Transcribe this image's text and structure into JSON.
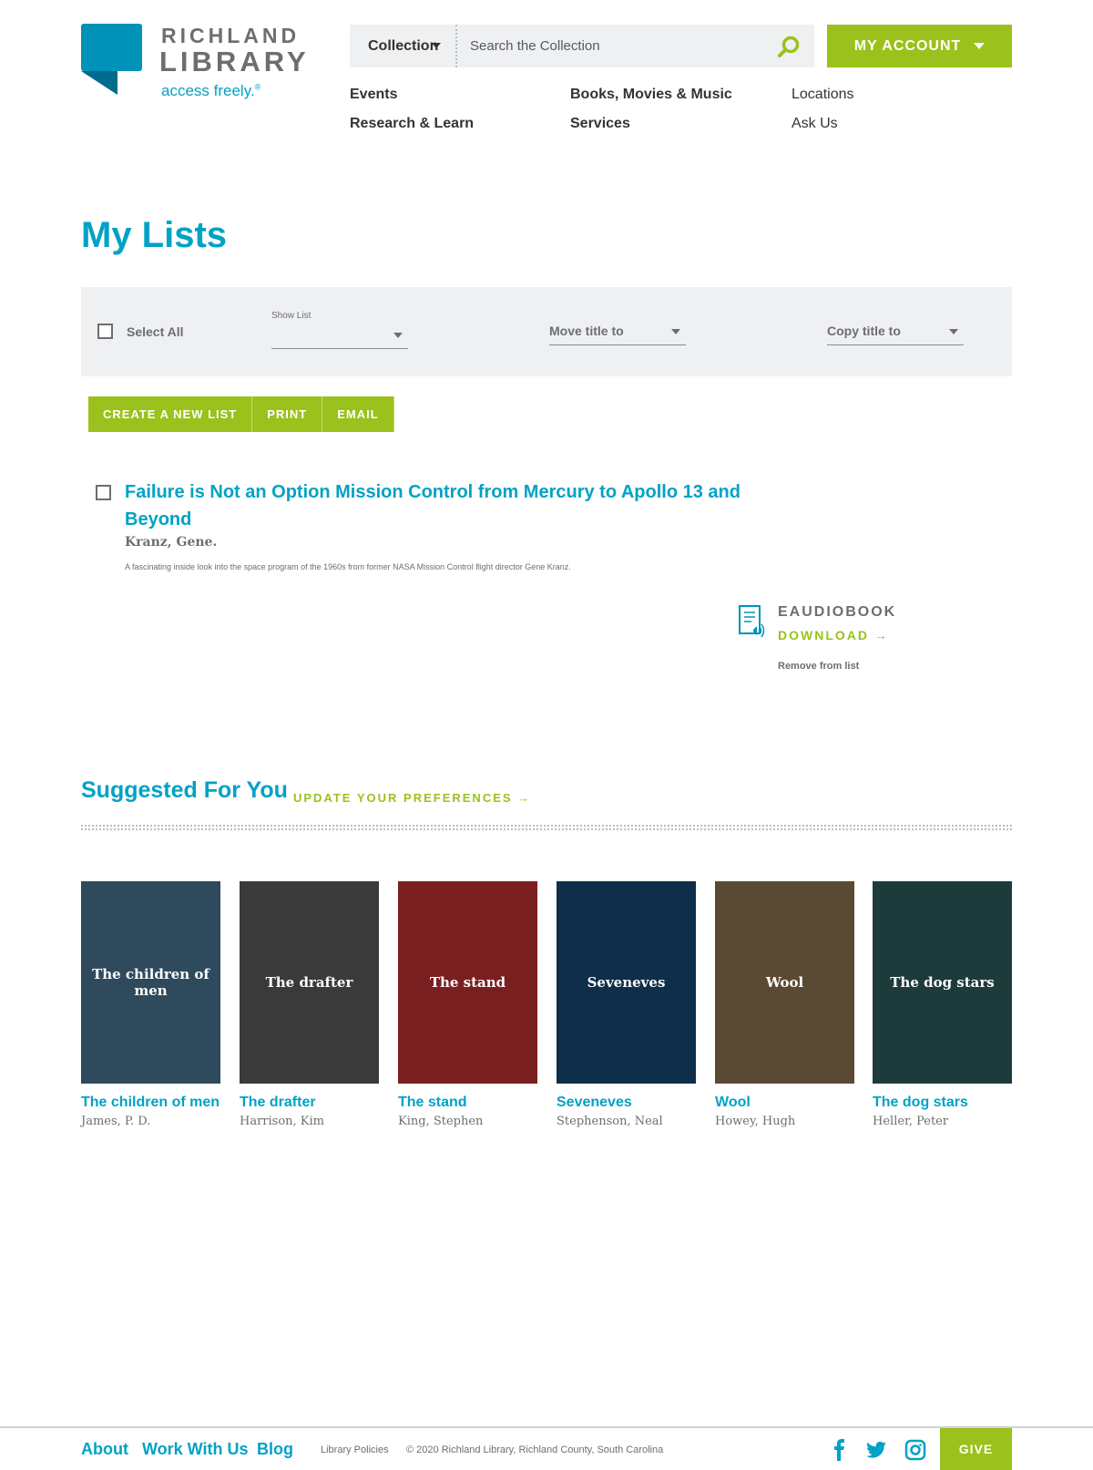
{
  "logo": {
    "line1": "RICHLAND",
    "line2": "LIBRARY",
    "tagline": "access freely.",
    "tagline_mark": "®"
  },
  "search": {
    "scope": "Collection",
    "placeholder": "Search the Collection"
  },
  "account": {
    "label": "MY ACCOUNT"
  },
  "nav": {
    "events": "Events",
    "books": "Books, Movies & Music",
    "locations": "Locations",
    "research": "Research & Learn",
    "services": "Services",
    "ask": "Ask Us"
  },
  "page_title": "My Lists",
  "toolbar": {
    "select_all": "Select All",
    "show_list_label": "Show List",
    "move_title": "Move title to",
    "copy_title": "Copy title to"
  },
  "actions": {
    "create": "CREATE A NEW LIST",
    "print": "PRINT",
    "email": "EMAIL"
  },
  "list_item": {
    "title": "Failure is Not an Option Mission Control from Mercury to Apollo 13 and Beyond",
    "author": "Kranz, Gene.",
    "description": "A fascinating inside look into the space program of the 1960s from former NASA Mission Control flight director Gene Kranz.",
    "format": "EAUDIOBOOK",
    "download": "DOWNLOAD →",
    "remove": "Remove from list"
  },
  "suggested": {
    "title": "Suggested For You",
    "preferences": "UPDATE YOUR PREFERENCES →",
    "books": [
      {
        "title": "The children of men",
        "author": "James, P. D.",
        "cover_color": "#2f4a5c"
      },
      {
        "title": "The drafter",
        "author": "Harrison, Kim",
        "cover_color": "#3a3a3a"
      },
      {
        "title": "The stand",
        "author": "King, Stephen",
        "cover_color": "#7a1f1f"
      },
      {
        "title": "Seveneves",
        "author": "Stephenson, Neal",
        "cover_color": "#0f2e4a"
      },
      {
        "title": "Wool",
        "author": "Howey, Hugh",
        "cover_color": "#5b4a33"
      },
      {
        "title": "The dog stars",
        "author": "Heller, Peter",
        "cover_color": "#1d3b3a"
      }
    ]
  },
  "footer": {
    "about": "About",
    "work": "Work With Us",
    "blog": "Blog",
    "policies": "Library Policies",
    "copyright": "© 2020 Richland Library, Richland County, South Carolina",
    "give": "GIVE"
  },
  "colors": {
    "brand_blue": "#00a2c6",
    "brand_green": "#9bc11c",
    "panel_gray": "#eef0f2"
  }
}
